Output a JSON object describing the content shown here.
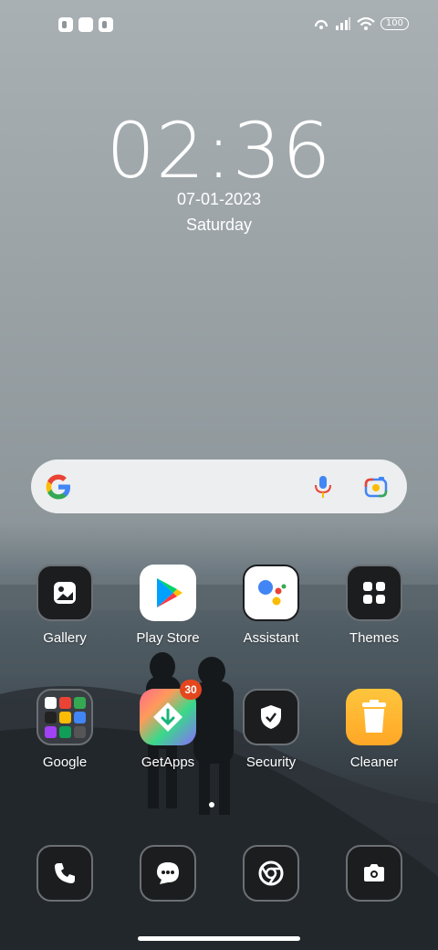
{
  "status_bar": {
    "battery": "100"
  },
  "lockscreen": {
    "time": "02:36",
    "date": "07-01-2023",
    "day": "Saturday"
  },
  "search": {
    "brand": "Google"
  },
  "apps_row1": [
    {
      "label": "Gallery",
      "icon": "gallery-icon"
    },
    {
      "label": "Play Store",
      "icon": "play-store-icon"
    },
    {
      "label": "Assistant",
      "icon": "assistant-icon"
    },
    {
      "label": "Themes",
      "icon": "themes-icon"
    }
  ],
  "apps_row2": [
    {
      "label": "Google",
      "icon": "google-folder-icon"
    },
    {
      "label": "GetApps",
      "icon": "getapps-icon",
      "badge": "30"
    },
    {
      "label": "Security",
      "icon": "security-icon"
    },
    {
      "label": "Cleaner",
      "icon": "cleaner-icon"
    }
  ],
  "dock": [
    {
      "icon": "phone-icon"
    },
    {
      "icon": "messages-icon"
    },
    {
      "icon": "chrome-icon"
    },
    {
      "icon": "camera-icon"
    }
  ],
  "colors": {
    "badge": "#e4471d",
    "search_bg": "#eceeef"
  }
}
